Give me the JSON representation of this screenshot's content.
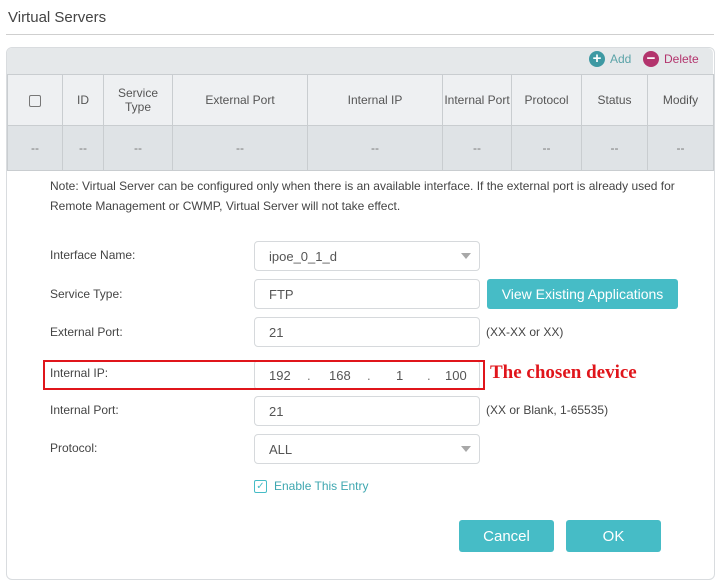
{
  "page": {
    "title": "Virtual Servers"
  },
  "toolbar": {
    "add_label": "Add",
    "delete_label": "Delete"
  },
  "table": {
    "headers": [
      "ID",
      "Service Type",
      "External Port",
      "Internal IP",
      "Internal Port",
      "Protocol",
      "Status",
      "Modify"
    ],
    "empty_row": [
      "--",
      "--",
      "--",
      "--",
      "--",
      "--",
      "--",
      "--",
      "--"
    ]
  },
  "note": "Note: Virtual Server can be configured only when there is an available interface. If the external port is already used for Remote Management or CWMP, Virtual Server will not take effect.",
  "form": {
    "interface_name": {
      "label": "Interface Name:",
      "value": "ipoe_0_1_d"
    },
    "service_type": {
      "label": "Service Type:",
      "value": "FTP",
      "button": "View Existing Applications"
    },
    "external_port": {
      "label": "External Port:",
      "value": "21",
      "hint": "(XX-XX or XX)"
    },
    "internal_ip": {
      "label": "Internal IP:",
      "octets": [
        "192",
        "168",
        "1",
        "100"
      ]
    },
    "internal_port": {
      "label": "Internal Port:",
      "value": "21",
      "hint": "(XX or Blank, 1-65535)"
    },
    "protocol": {
      "label": "Protocol:",
      "value": "ALL"
    },
    "enable_entry": {
      "label": "Enable This Entry",
      "checked": true
    }
  },
  "buttons": {
    "cancel": "Cancel",
    "ok": "OK"
  },
  "annotation": {
    "text": "The chosen device",
    "color": "#e0151b"
  },
  "colors": {
    "accent": "#46bcc6",
    "delete": "#b3346d",
    "highlight": "#e0151b"
  }
}
